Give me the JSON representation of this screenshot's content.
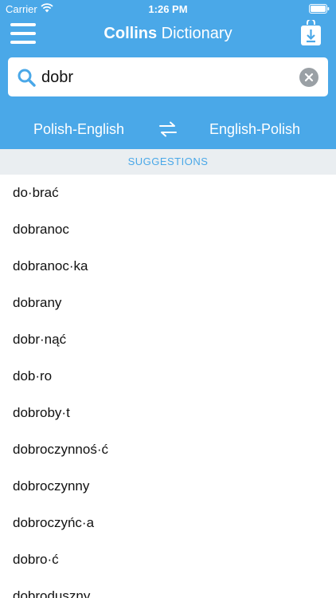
{
  "status_bar": {
    "carrier": "Carrier",
    "time": "1:26 PM",
    "icons": [
      "wifi-icon",
      "battery-icon"
    ]
  },
  "header": {
    "title_brand": "Collins",
    "title_rest": " Dictionary",
    "icons": [
      "menu-icon",
      "download-icon"
    ]
  },
  "search": {
    "value": "dobr",
    "icons": [
      "search-icon",
      "clear-icon"
    ]
  },
  "language": {
    "left": "Polish-English",
    "right": "English-Polish",
    "icon": "swap-icon"
  },
  "suggestions": {
    "header": "SUGGESTIONS",
    "items": [
      "do·brać",
      "dobranoc",
      "dobranoc·ka",
      "dobrany",
      "dobr·nąć",
      "dob·ro",
      "dobroby·t",
      "dobroczynnoś·ć",
      "dobroczynny",
      "dobroczyńc·a",
      "dobro·ć",
      "dobroduszny"
    ]
  },
  "colors": {
    "accent": "#4aa8e8",
    "suggestions_bg": "#eaeef1",
    "clear_gray": "#9aa0a5"
  }
}
